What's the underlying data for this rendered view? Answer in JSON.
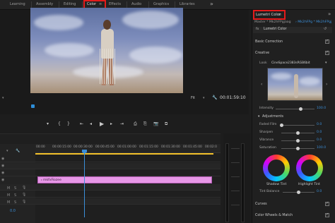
{
  "workspaces": {
    "items": [
      "Learning",
      "Assembly",
      "Editing",
      "Color",
      "Effects",
      "Audio",
      "Graphics",
      "Libraries"
    ],
    "more": "»",
    "menu_icon": "≡"
  },
  "monitor": {
    "fit": "Fit",
    "fit_caret": "▾",
    "timecode": "00:01:59:10",
    "wrench_icon": "wrench-icon"
  },
  "transport": {
    "icons": [
      "marker-icon",
      "in-point-icon",
      "out-point-icon",
      "go-to-in-icon",
      "step-back-icon",
      "play-icon",
      "step-forward-icon",
      "go-to-out-icon",
      "insert-icon",
      "overwrite-icon",
      "export-frame-icon",
      "comparison-icon"
    ]
  },
  "timeline": {
    "ruler": [
      "00:00",
      "00:00:15:00",
      "00:00:30:00",
      "00:00:45:00",
      "00:01:00:00",
      "00:01:15:00",
      "00:01:30:00",
      "00:01:45:00",
      "00:02:0"
    ],
    "clip_label": "🞄 mkfxFiozee",
    "bottom_value": "0.0"
  },
  "lumetri": {
    "title": "Lumetri Color",
    "close": "≡",
    "more": "»",
    "master_label": "Master * Mk2hFPgjaag",
    "master_link": "› Mk2hFPg * Mk2hFPgj",
    "fx": "Lumetri Color",
    "fx_prefix": "fx",
    "reset": "↺",
    "basic_correction": "Basic Correction",
    "creative": "Creative",
    "look_label": "Look",
    "look_value": "CineSpace2383sRGB6bit",
    "intensity_label": "Intensity",
    "intensity_value": "100.0",
    "adjustments": "Adjustments",
    "faded_film_label": "Faded Film",
    "faded_film_value": "0.0",
    "sharpen_label": "Sharpen",
    "sharpen_value": "0.0",
    "vibrance_label": "Vibrance",
    "vibrance_value": "0.0",
    "saturation_label": "Saturation",
    "saturation_value": "100.0",
    "shadow_tint": "Shadow Tint",
    "highlight_tint": "Highlight Tint",
    "tint_balance_label": "Tint Balance",
    "tint_balance_value": "0.0",
    "curves": "Curves",
    "color_wheels": "Color Wheels & Match",
    "levels": {
      "intensity": 1.0,
      "faded_film": 0.0,
      "sharpen": 0.0,
      "vibrance": 0.0,
      "saturation": 0.5,
      "tint_balance": 0.5
    }
  }
}
